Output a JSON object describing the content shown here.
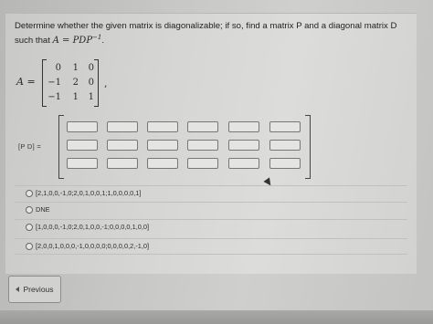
{
  "question": {
    "text_before": "Determine whether the given matrix is diagonalizable; if so, find a matrix P and a diagonal matrix D such that ",
    "equation": "A = PDP",
    "exponent": "−1",
    "text_after": "."
  },
  "matrix_a": {
    "label": "A =",
    "rows": [
      [
        "0",
        "1",
        "0"
      ],
      [
        "−1",
        "2",
        "0"
      ],
      [
        "−1",
        "1",
        "1"
      ]
    ],
    "trailing": ","
  },
  "answer_grid": {
    "label": "[P D] =",
    "rows": 3,
    "cols": 6
  },
  "options": [
    {
      "label": "[2,1,0,0,-1,0;2,0,1,0,0,1;1,0,0,0,0,1]"
    },
    {
      "label": "DNE"
    },
    {
      "label": "[1,0,0,0,-1,0;2,0,1,0,0,-1;0,0,0,0,1,0,0]"
    },
    {
      "label": "[2,0,0,1,0,0,0,-1,0,0,0,0;0,0,0,0,2,-1,0]"
    }
  ],
  "navigation": {
    "previous_label": "Previous"
  }
}
